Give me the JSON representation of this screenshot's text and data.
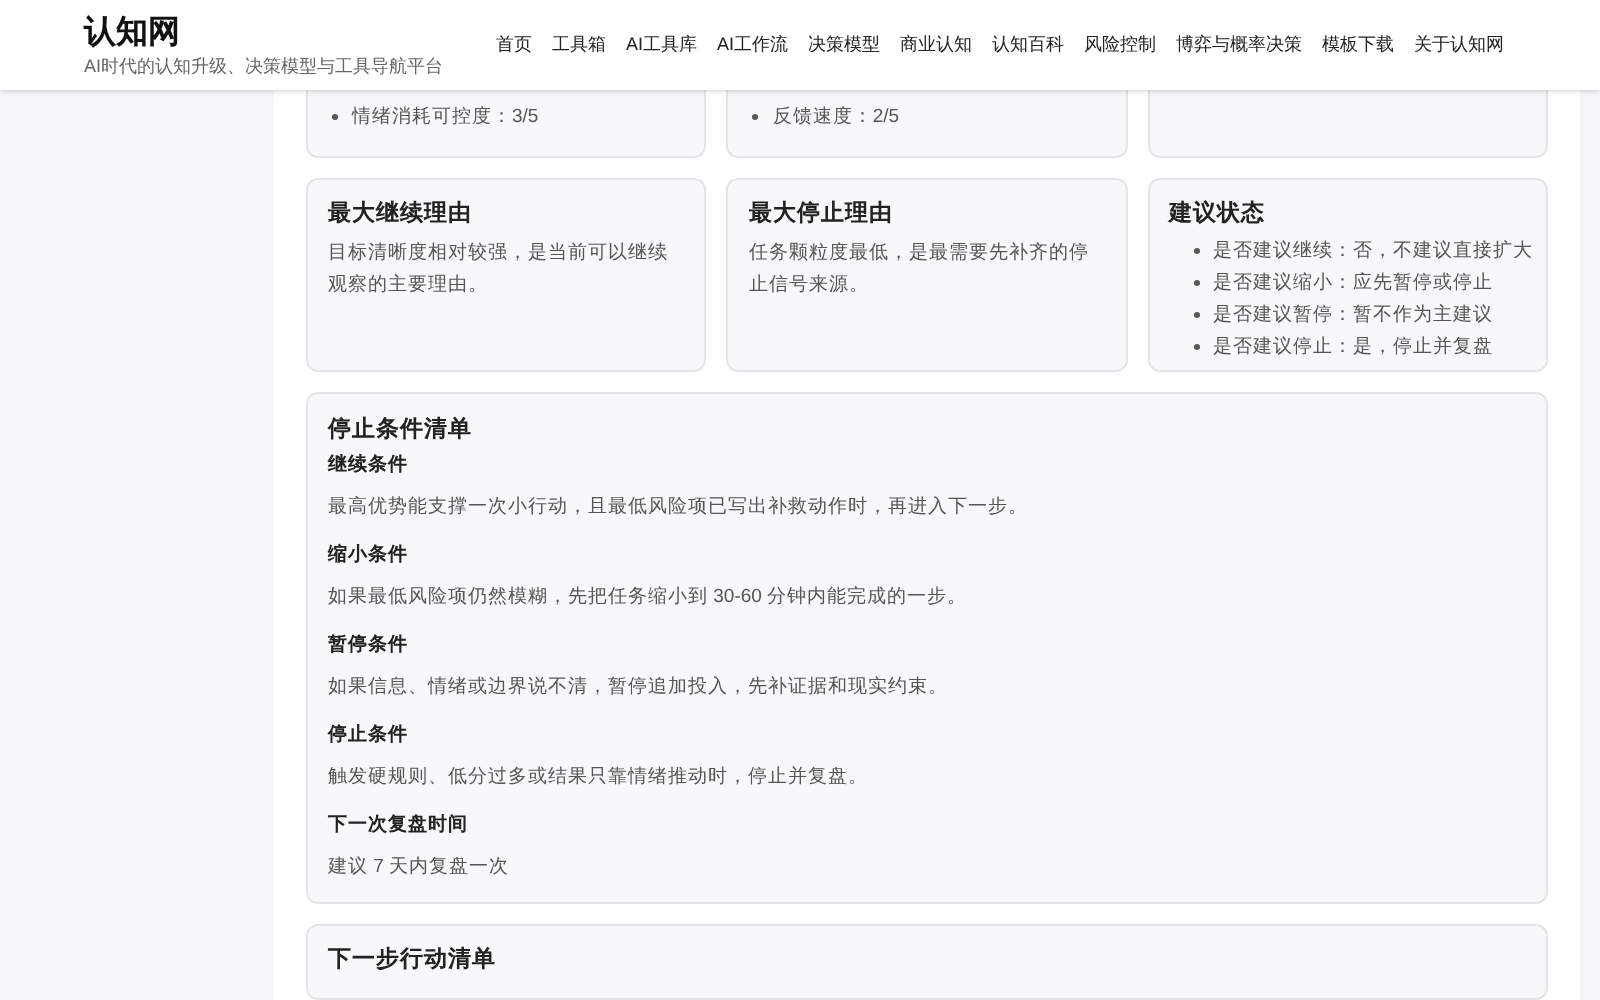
{
  "header": {
    "site_title": "认知网",
    "tagline": "AI时代的认知升级、决策模型与工具导航平台",
    "nav": [
      {
        "label": "首页"
      },
      {
        "label": "工具箱"
      },
      {
        "label": "AI工具库"
      },
      {
        "label": "AI工作流"
      },
      {
        "label": "决策模型"
      },
      {
        "label": "商业认知"
      },
      {
        "label": "认知百科"
      },
      {
        "label": "风险控制"
      },
      {
        "label": "博弈与概率决策"
      },
      {
        "label": "模板下载"
      },
      {
        "label": "关于认知网"
      }
    ]
  },
  "top_cards": [
    {
      "kind": "list",
      "items": [
        "情绪消耗可控度：3/5"
      ]
    },
    {
      "kind": "list",
      "items": [
        "反馈速度：2/5"
      ]
    },
    {
      "kind": "empty"
    }
  ],
  "cards": [
    {
      "kind": "text",
      "title": "最大继续理由",
      "body": "目标清晰度相对较强，是当前可以继续观察的主要理由。"
    },
    {
      "kind": "text",
      "title": "最大停止理由",
      "body": "任务颗粒度最低，是最需要先补齐的停止信号来源。"
    },
    {
      "kind": "list",
      "title": "建议状态",
      "items": [
        "是否建议继续：否，不建议直接扩大",
        "是否建议缩小：应先暂停或停止",
        "是否建议暂停：暂不作为主建议",
        "是否建议停止：是，停止并复盘"
      ]
    }
  ],
  "stop_conditions": {
    "title": "停止条件清单",
    "sections": [
      {
        "heading": "继续条件",
        "text": "最高优势能支撑一次小行动，且最低风险项已写出补救动作时，再进入下一步。"
      },
      {
        "heading": "缩小条件",
        "text": "如果最低风险项仍然模糊，先把任务缩小到 30-60 分钟内能完成的一步。"
      },
      {
        "heading": "暂停条件",
        "text": "如果信息、情绪或边界说不清，暂停追加投入，先补证据和现实约束。"
      },
      {
        "heading": "停止条件",
        "text": "触发硬规则、低分过多或结果只靠情绪推动时，停止并复盘。"
      },
      {
        "heading": "下一次复盘时间",
        "text": "建议 7 天内复盘一次"
      }
    ]
  },
  "next_card": {
    "title": "下一步行动清单"
  }
}
